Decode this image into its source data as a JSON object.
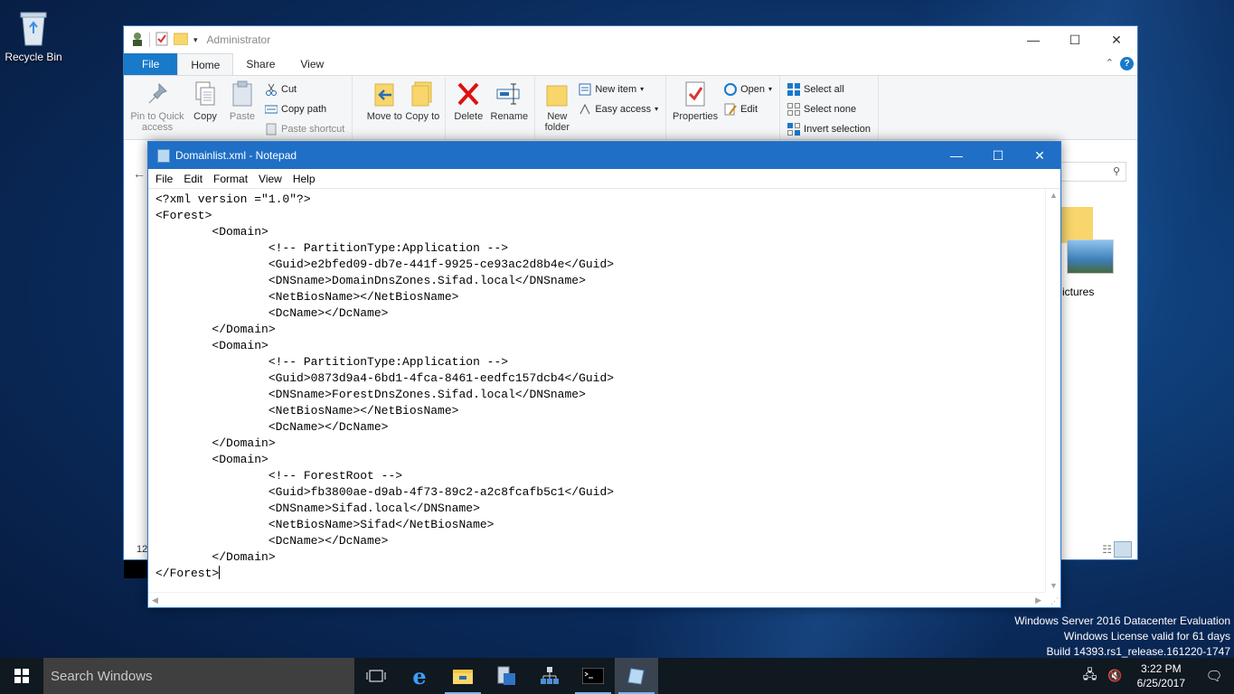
{
  "desktop": {
    "recycle_bin_label": "Recycle Bin",
    "watermark": {
      "line1": "Windows Server 2016 Datacenter Evaluation",
      "line2": "Windows License valid for 61 days",
      "line3": "Build 14393.rs1_release.161220-1747"
    }
  },
  "explorer": {
    "title": "Administrator",
    "tabs": [
      "File",
      "Home",
      "Share",
      "View"
    ],
    "ribbon": {
      "pin_label": "Pin to Quick access",
      "copy_label": "Copy",
      "paste_label": "Paste",
      "cut_label": "Cut",
      "copy_path_label": "Copy path",
      "paste_shortcut_label": "Paste shortcut",
      "move_to_label": "Move to",
      "copy_to_label": "Copy to",
      "delete_label": "Delete",
      "rename_label": "Rename",
      "new_folder_label": "New folder",
      "new_item_label": "New item",
      "easy_access_label": "Easy access",
      "properties_label": "Properties",
      "open_label": "Open",
      "edit_label": "Edit",
      "select_all_label": "Select all",
      "select_none_label": "Select none",
      "invert_selection_label": "Invert selection"
    },
    "pictures_label": "ictures",
    "status_count": "12"
  },
  "notepad": {
    "title": "Domainlist.xml - Notepad",
    "menu": [
      "File",
      "Edit",
      "Format",
      "View",
      "Help"
    ],
    "lines": [
      "<?xml version =\"1.0\"?>",
      "<Forest>",
      "\t<Domain>",
      "\t\t<!-- PartitionType:Application -->",
      "\t\t<Guid>e2bfed09-db7e-441f-9925-ce93ac2d8b4e</Guid>",
      "\t\t<DNSname>DomainDnsZones.Sifad.local</DNSname>",
      "\t\t<NetBiosName></NetBiosName>",
      "\t\t<DcName></DcName>",
      "\t</Domain>",
      "\t<Domain>",
      "\t\t<!-- PartitionType:Application -->",
      "\t\t<Guid>0873d9a4-6bd1-4fca-8461-eedfc157dcb4</Guid>",
      "\t\t<DNSname>ForestDnsZones.Sifad.local</DNSname>",
      "\t\t<NetBiosName></NetBiosName>",
      "\t\t<DcName></DcName>",
      "\t</Domain>",
      "\t<Domain>",
      "\t\t<!-- ForestRoot -->",
      "\t\t<Guid>fb3800ae-d9ab-4f73-89c2-a2c8fcafb5c1</Guid>",
      "\t\t<DNSname>Sifad.local</DNSname>",
      "\t\t<NetBiosName>Sifad</NetBiosName>",
      "\t\t<DcName></DcName>",
      "\t</Domain>",
      "</Forest>"
    ]
  },
  "taskbar": {
    "search_placeholder": "Search Windows",
    "time": "3:22 PM",
    "date": "6/25/2017"
  }
}
